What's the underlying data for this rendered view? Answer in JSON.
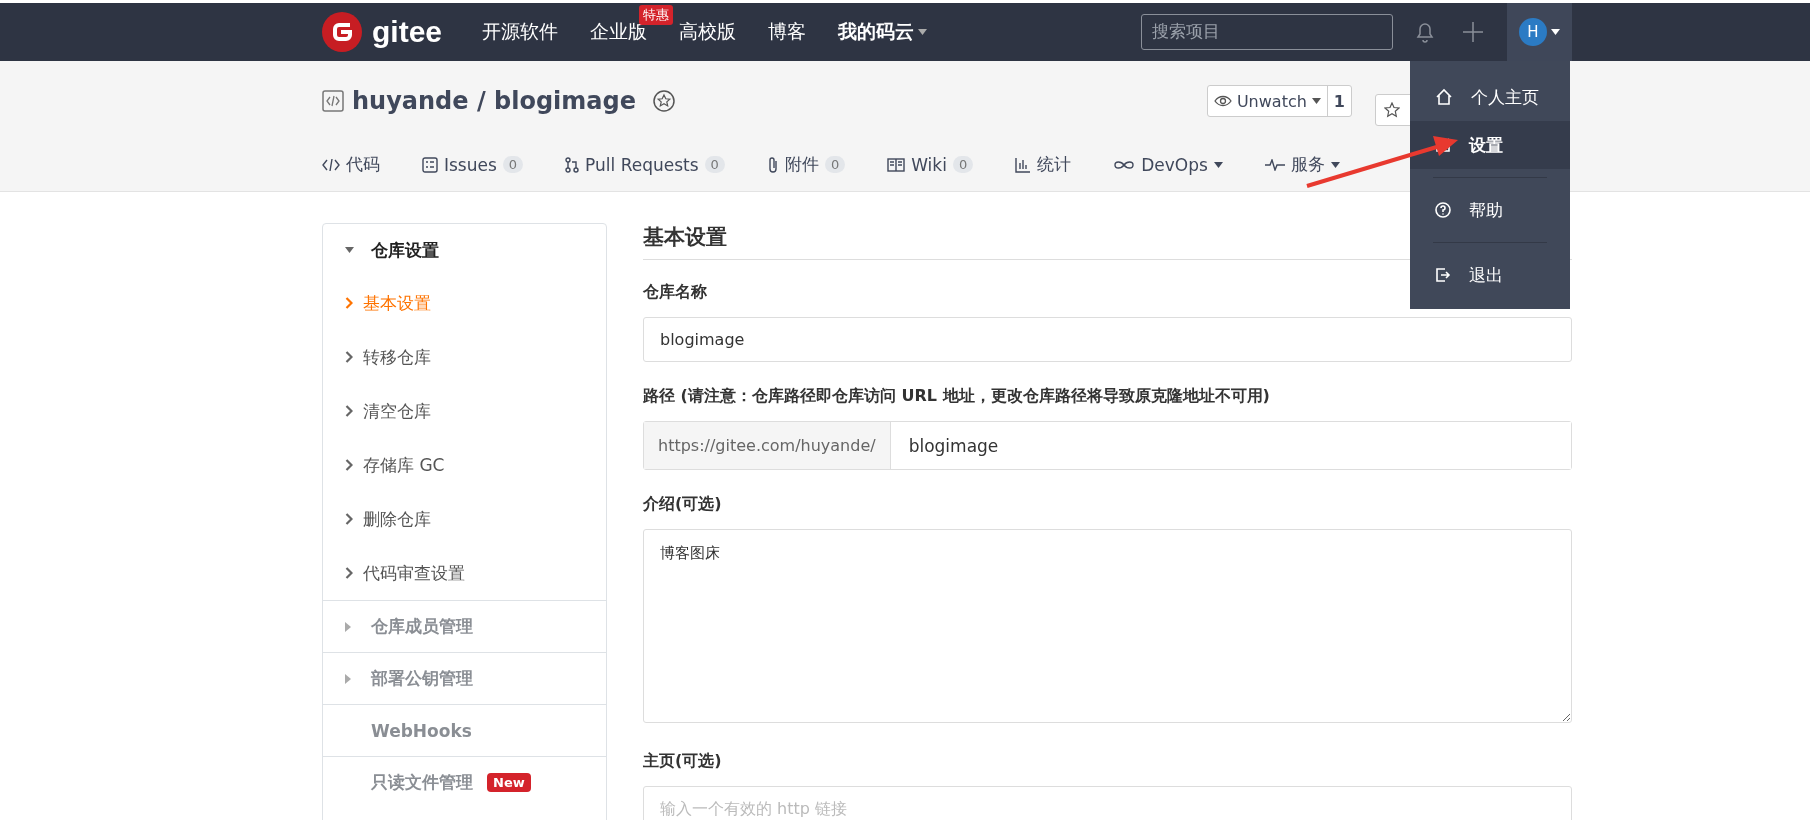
{
  "header": {
    "logo": "gitee",
    "nav": [
      {
        "label": "开源软件",
        "bold": false,
        "dropdown": false
      },
      {
        "label": "企业版",
        "badge": "特惠",
        "bold": false,
        "dropdown": false
      },
      {
        "label": "高校版",
        "bold": false,
        "dropdown": false
      },
      {
        "label": "博客",
        "bold": false,
        "dropdown": false
      },
      {
        "label": "我的码云",
        "bold": true,
        "dropdown": true
      }
    ],
    "search": {
      "placeholder": "搜索项目"
    },
    "avatar": "H"
  },
  "repo": {
    "title": "huyande / blogimage",
    "watch": {
      "label": "Unwatch",
      "count": "1"
    },
    "tabs": [
      {
        "label": "代码",
        "dropdown": false,
        "selected": false
      },
      {
        "label": "Issues",
        "count": "0",
        "dropdown": false,
        "selected": false
      },
      {
        "label": "Pull Requests",
        "count": "0",
        "dropdown": false,
        "selected": false
      },
      {
        "label": "附件",
        "count": "0",
        "dropdown": false,
        "selected": false
      },
      {
        "label": "Wiki",
        "count": "0",
        "dropdown": false,
        "selected": false
      },
      {
        "label": "统计",
        "dropdown": false,
        "selected": false
      },
      {
        "label": "DevOps",
        "dropdown": true,
        "selected": false
      },
      {
        "label": "服务",
        "dropdown": true,
        "selected": false
      }
    ]
  },
  "user_menu": {
    "items": [
      {
        "label": "个人主页",
        "selected": false
      },
      {
        "label": "设置",
        "selected": true
      },
      {
        "label": "帮助",
        "selected": false
      },
      {
        "label": "退出",
        "selected": false
      }
    ]
  },
  "sidebar": {
    "sections": [
      {
        "label": "仓库设置",
        "expandable": true,
        "expanded": true,
        "children": [
          {
            "label": "基本设置",
            "selected": true
          },
          {
            "label": "转移仓库",
            "selected": false
          },
          {
            "label": "清空仓库",
            "selected": false
          },
          {
            "label": "存储库 GC",
            "selected": false
          },
          {
            "label": "删除仓库",
            "selected": false
          },
          {
            "label": "代码审查设置",
            "selected": false
          }
        ]
      },
      {
        "label": "仓库成员管理",
        "expandable": true,
        "expanded": false
      },
      {
        "label": "部署公钥管理",
        "expandable": true,
        "expanded": false
      },
      {
        "label": "WebHooks",
        "expandable": false,
        "expanded": false
      },
      {
        "label": "只读文件管理",
        "expandable": false,
        "expanded": false,
        "badge": "New"
      }
    ]
  },
  "form": {
    "title": "基本设置",
    "fields": [
      {
        "kind": "input",
        "label": "仓库名称",
        "value": "blogimage"
      },
      {
        "kind": "prefixed",
        "label": "路径 (请注意：仓库路径即仓库访问 URL 地址，更改仓库路径将导致原克隆地址不可用)",
        "prefix": "https://gitee.com/huyande/",
        "value": "blogimage"
      },
      {
        "kind": "textarea",
        "label": "介绍(可选)",
        "value": "博客图床"
      },
      {
        "kind": "input",
        "label": "主页(可选)",
        "placeholder": "输入一个有效的 http 链接"
      }
    ]
  }
}
